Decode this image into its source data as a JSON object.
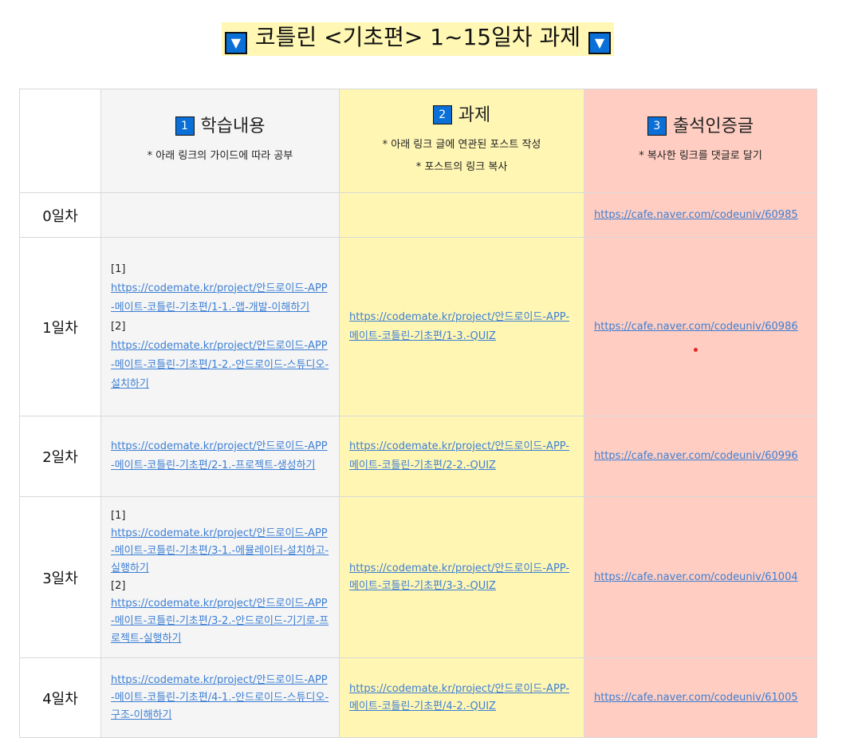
{
  "title": "코틀린 <기초편> 1~15일차 과제",
  "title_icon": "down-triangle-icon",
  "headers": [
    {
      "num": "1",
      "title": "학습내용",
      "notes": [
        "* 아래 링크의 가이드에 따라 공부"
      ]
    },
    {
      "num": "2",
      "title": "과제",
      "notes": [
        "* 아래 링크 글에 연관된 포스트 작성",
        "* 포스트의 링크 복사"
      ]
    },
    {
      "num": "3",
      "title": "출석인증글",
      "notes": [
        "* 복사한 링크를 댓글로 달기"
      ]
    }
  ],
  "rows": [
    {
      "day": "0일차",
      "study": [],
      "task": "",
      "attendance": "https://cafe.naver.com/codeuniv/60985"
    },
    {
      "day": "1일차",
      "study": [
        {
          "label": "[1]",
          "url": "https://codemate.kr/project/안드로이드-APP-메이트-코틀린-기초편/1-1.-앱-개발-이해하기"
        },
        {
          "label": "[2]",
          "url": "https://codemate.kr/project/안드로이드-APP-메이트-코틀린-기초편/1-2.-안드로이드-스튜디오-설치하기"
        }
      ],
      "task": "https://codemate.kr/project/안드로이드-APP-메이트-코틀린-기초편/1-3.-QUIZ",
      "attendance": "https://cafe.naver.com/codeuniv/60986"
    },
    {
      "day": "2일차",
      "study": [
        {
          "label": "",
          "url": "https://codemate.kr/project/안드로이드-APP-메이트-코틀린-기초편/2-1.-프로젝트-생성하기"
        }
      ],
      "task": "https://codemate.kr/project/안드로이드-APP-메이트-코틀린-기초편/2-2.-QUIZ",
      "attendance": "https://cafe.naver.com/codeuniv/60996"
    },
    {
      "day": "3일차",
      "study": [
        {
          "label": "[1]",
          "url": "https://codemate.kr/project/안드로이드-APP-메이트-코틀린-기초편/3-1.-에뮬레이터-설치하고-실행하기"
        },
        {
          "label": "[2]",
          "url": "https://codemate.kr/project/안드로이드-APP-메이트-코틀린-기초편/3-2.-안드로이드-기기로-프로젝트-실행하기"
        }
      ],
      "task": "https://codemate.kr/project/안드로이드-APP-메이트-코틀린-기초편/3-3.-QUIZ",
      "attendance": "https://cafe.naver.com/codeuniv/61004"
    },
    {
      "day": "4일차",
      "study": [
        {
          "label": "",
          "url": "https://codemate.kr/project/안드로이드-APP-메이트-코틀린-기초편/4-1.-안드로이드-스튜디오-구조-이해하기"
        }
      ],
      "task": "https://codemate.kr/project/안드로이드-APP-메이트-코틀린-기초편/4-2.-QUIZ",
      "attendance": "https://cafe.naver.com/codeuniv/61005"
    }
  ],
  "colors": {
    "accent_blue": "#0a6fd6",
    "col_study": "#f5f5f5",
    "col_task": "#fff6b4",
    "col_attendance": "#ffcdc1",
    "link": "#3d7fd4"
  }
}
